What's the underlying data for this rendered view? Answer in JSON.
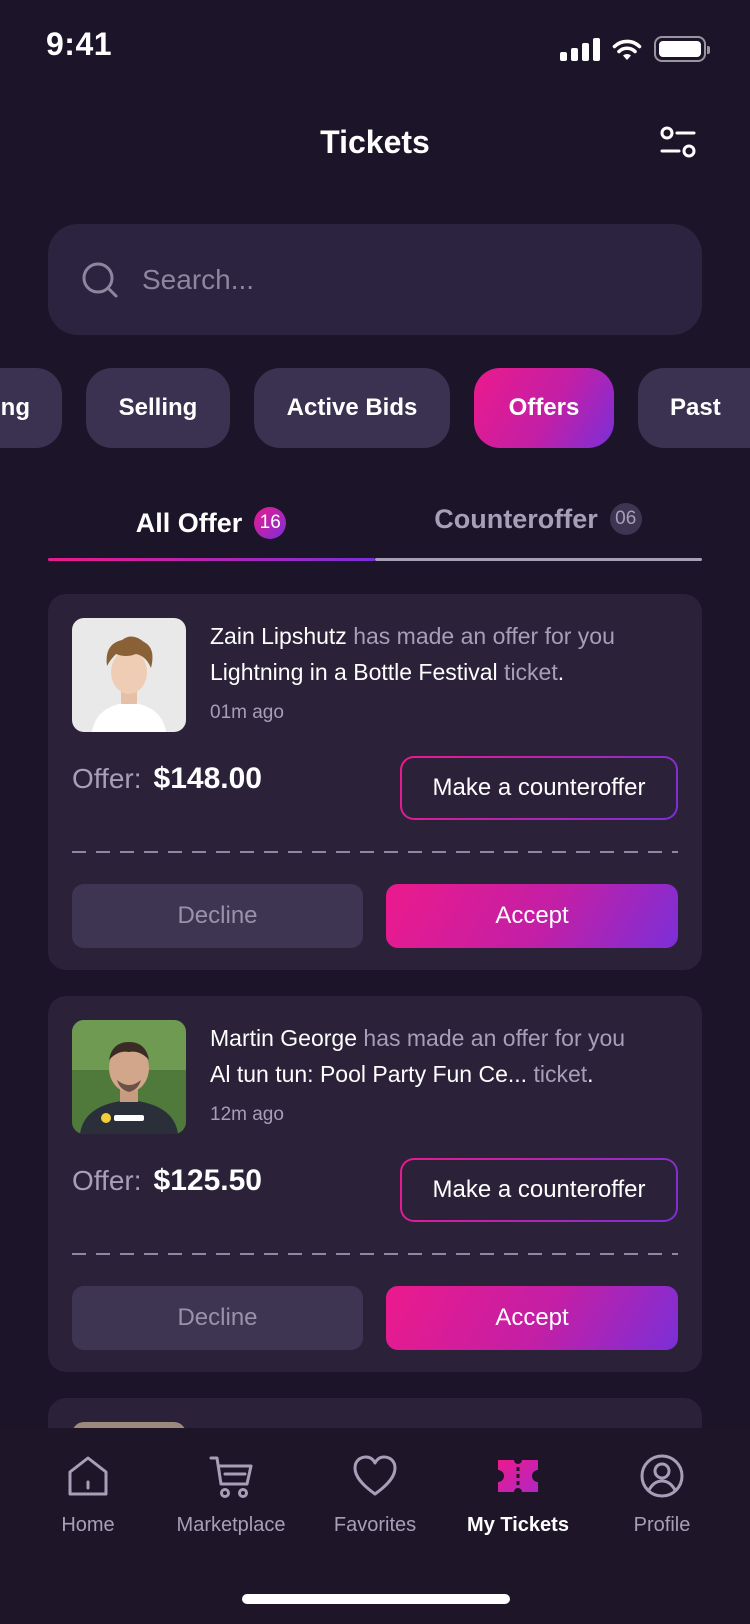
{
  "status": {
    "time": "9:41"
  },
  "header": {
    "title": "Tickets"
  },
  "search": {
    "placeholder": "Search..."
  },
  "chips": [
    {
      "label": "Buying",
      "active": false
    },
    {
      "label": "Selling",
      "active": false
    },
    {
      "label": "Active Bids",
      "active": false
    },
    {
      "label": "Offers",
      "active": true
    },
    {
      "label": "Past",
      "active": false
    }
  ],
  "tabs": [
    {
      "label": "All Offer",
      "badge": "16",
      "active": true
    },
    {
      "label": "Counteroffer",
      "badge": "06",
      "active": false
    }
  ],
  "offers": [
    {
      "name": "Zain Lipshutz",
      "message": " has made an offer for you",
      "event": "Lightning in a Bottle Festival",
      "suffix": " ticket",
      "period": ".",
      "time": "01m ago",
      "offer_label": "Offer:",
      "amount": "$148.00",
      "counter_label": "Make a counteroffer",
      "decline_label": "Decline",
      "accept_label": "Accept"
    },
    {
      "name": "Martin George",
      "message": " has made an offer for you",
      "event": "Al tun tun: Pool Party Fun Ce...",
      "suffix": " ticket",
      "period": ".",
      "time": "12m ago",
      "offer_label": "Offer:",
      "amount": "$125.50",
      "counter_label": "Make a counteroffer",
      "decline_label": "Decline",
      "accept_label": "Accept"
    }
  ],
  "nav": [
    {
      "label": "Home",
      "icon": "home-icon",
      "active": false
    },
    {
      "label": "Marketplace",
      "icon": "cart-icon",
      "active": false
    },
    {
      "label": "Favorites",
      "icon": "heart-icon",
      "active": false
    },
    {
      "label": "My Tickets",
      "icon": "ticket-icon",
      "active": true
    },
    {
      "label": "Profile",
      "icon": "profile-icon",
      "active": false
    }
  ],
  "colors": {
    "background": "#1c1428",
    "card": "#2b2139",
    "accent_start": "#ec1a8c",
    "accent_end": "#7b2fd8"
  }
}
